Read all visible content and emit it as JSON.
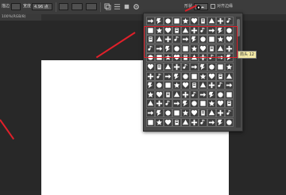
{
  "optionsBar": {
    "styleLabel": "描边",
    "widthLabel": "宽度",
    "widthValue": "4.96 点",
    "shapeLabel": "形状",
    "alignLabel": "对齐边缘"
  },
  "documentTab": {
    "title": "100%(RGB/8)"
  },
  "shapePicker": {
    "tooltip": "箭头 12",
    "rowCount": 12,
    "colCount": 10
  },
  "colors": {
    "annotation": "#e0202a",
    "panel": "#4a4a4a",
    "canvas": "#ffffff"
  },
  "icons": [
    "gear-icon",
    "shape-preview-icon",
    "checkbox-icon"
  ]
}
